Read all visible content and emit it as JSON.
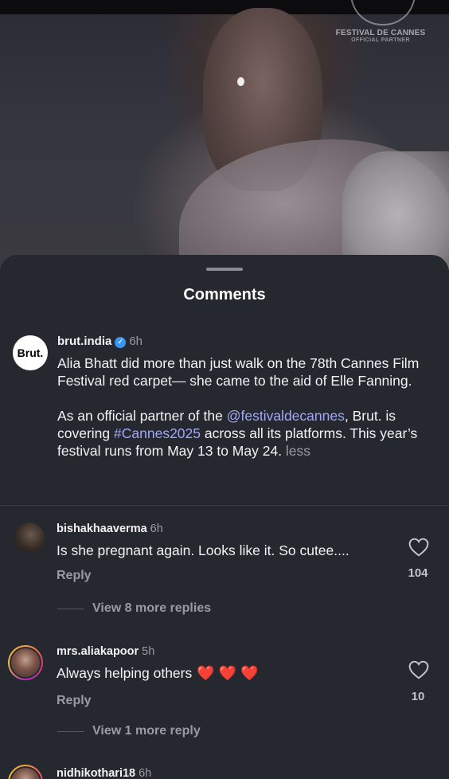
{
  "video": {
    "watermark_title": "FESTIVAL DE CANNES",
    "watermark_subtitle": "OFFICIAL PARTNER"
  },
  "sheet": {
    "title": "Comments"
  },
  "caption": {
    "avatar_label": "Brut.",
    "username": "brut.india",
    "verified_icon": "verified-badge-icon",
    "time": "6h",
    "paragraph1": "Alia Bhatt did more than just walk on the 78th Cannes Film Festival red carpet— she came to the aid of Elle Fanning.",
    "p2_part1": "As an official partner of the ",
    "p2_mention": "@festivaldecannes",
    "p2_part2": ", Brut. is covering ",
    "p2_hashtag": "#Cannes2025",
    "p2_part3": " across all its platforms. This year’s festival runs from May 13 to May 24. ",
    "less_label": "less"
  },
  "comments": [
    {
      "username": "bishakhaaverma",
      "time": "6h",
      "text": "Is she pregnant again. Looks like it. So cutee....",
      "reply_label": "Reply",
      "likes": "104",
      "view_more": "View 8 more replies"
    },
    {
      "username": "mrs.aliakapoor",
      "time": "5h",
      "text": "Always helping others",
      "emoji": "❤️ ❤️ ❤️",
      "reply_label": "Reply",
      "likes": "10",
      "view_more": "View 1 more reply"
    },
    {
      "username": "nidhikothari18",
      "time": "6h"
    }
  ],
  "colors": {
    "sheet_bg": "#26282f",
    "link": "#a2a8f5",
    "verified": "#3897f0",
    "heart_emoji": "#ec1c24"
  }
}
